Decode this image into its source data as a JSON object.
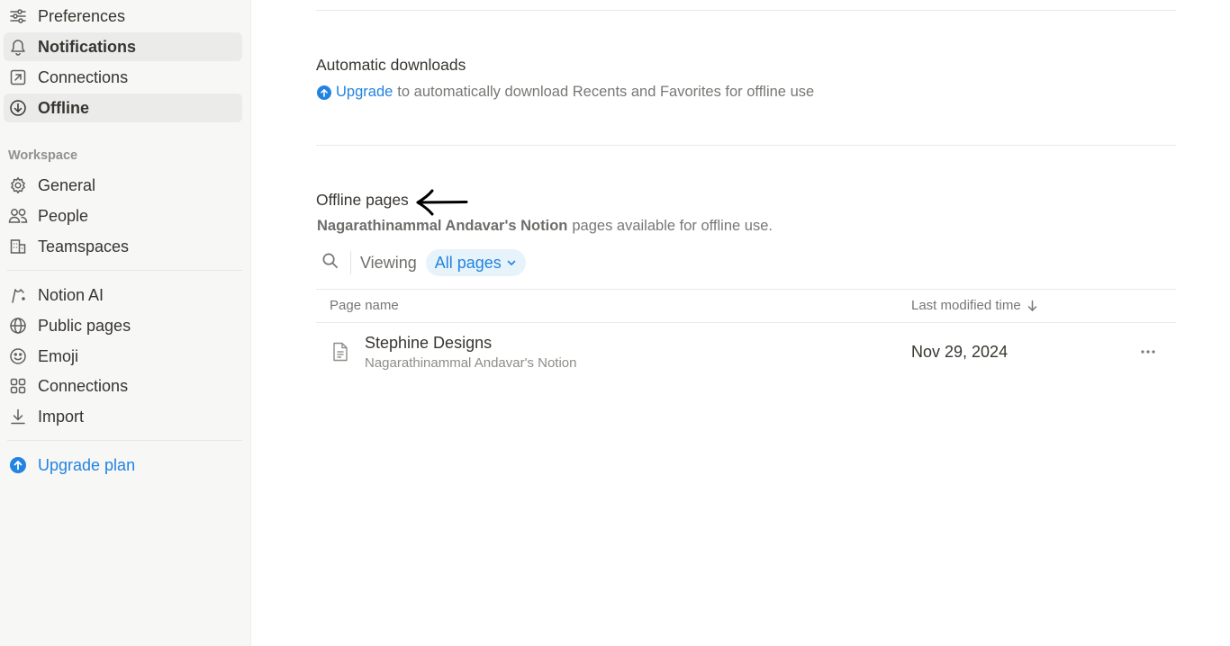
{
  "sidebar": {
    "account_items": [
      {
        "label": "Preferences",
        "icon": "sliders-icon"
      },
      {
        "label": "Notifications",
        "icon": "bell-icon"
      },
      {
        "label": "Connections",
        "icon": "external-link-icon"
      },
      {
        "label": "Offline",
        "icon": "download-circle-icon"
      }
    ],
    "workspace_heading": "Workspace",
    "workspace_items": [
      {
        "label": "General",
        "icon": "gear-icon"
      },
      {
        "label": "People",
        "icon": "people-icon"
      },
      {
        "label": "Teamspaces",
        "icon": "building-icon"
      }
    ],
    "feature_items": [
      {
        "label": "Notion AI",
        "icon": "notion-ai-icon"
      },
      {
        "label": "Public pages",
        "icon": "globe-icon"
      },
      {
        "label": "Emoji",
        "icon": "smiley-icon"
      },
      {
        "label": "Connections",
        "icon": "grid-icon"
      },
      {
        "label": "Import",
        "icon": "import-icon"
      }
    ],
    "upgrade_label": "Upgrade plan",
    "active_item": "Offline"
  },
  "automatic_downloads": {
    "title": "Automatic downloads",
    "link": "Upgrade",
    "text": "to automatically download Recents and Favorites for offline use"
  },
  "offline_pages": {
    "title": "Offline pages",
    "workspace_name": "Nagarathinammal Andavar's Notion",
    "desc_suffix": "pages available for offline use.",
    "viewing_label": "Viewing",
    "filter_value": "All pages",
    "columns": {
      "name": "Page name",
      "modified": "Last modified time"
    },
    "rows": [
      {
        "name": "Stephine Designs",
        "workspace": "Nagarathinammal Andavar's Notion",
        "date": "Nov 29, 2024"
      }
    ]
  },
  "colors": {
    "accent": "#2383e2",
    "sidebar_bg": "#f7f7f5",
    "chip_bg": "#e7f3fb"
  }
}
